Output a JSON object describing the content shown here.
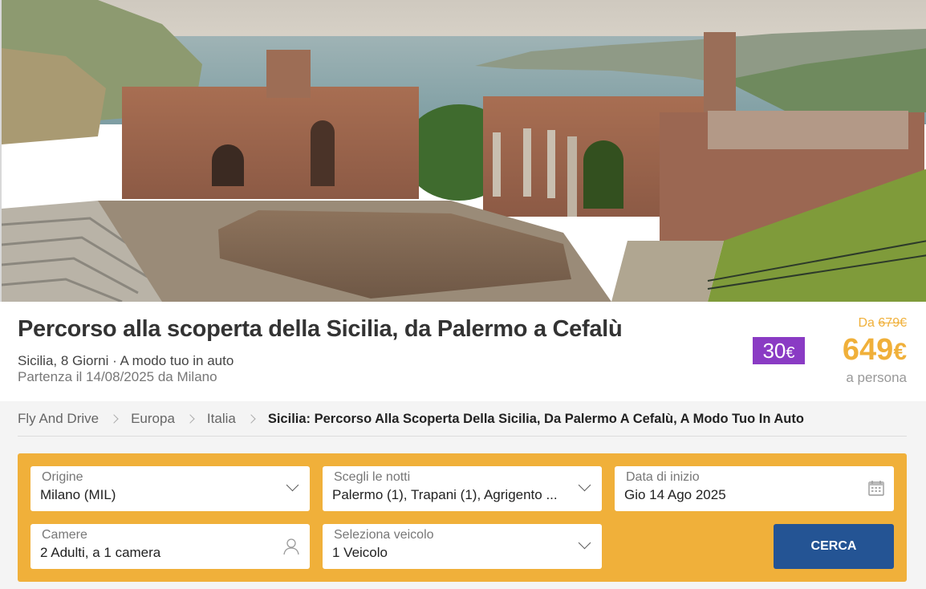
{
  "hero": {
    "image_alt": "Teatro Antico di Taormina, Sicilia"
  },
  "header": {
    "title": "Percorso alla scoperta della Sicilia, da Palermo a Cefalù",
    "subtitle": "Sicilia, 8 Giorni · A modo tuo in auto",
    "departure": "Partenza il 14/08/2025 da Milano",
    "discount_value": "30",
    "discount_currency": "€",
    "price_prefix": "Da",
    "old_price": "679€",
    "new_price_value": "649",
    "new_price_currency": "€",
    "per_person": "a persona"
  },
  "breadcrumb": {
    "items": [
      "Fly And Drive",
      "Europa",
      "Italia"
    ],
    "current": "Sicilia: Percorso Alla Scoperta Della Sicilia, Da Palermo A Cefalù, A Modo Tuo In Auto"
  },
  "search": {
    "origin": {
      "label": "Origine",
      "value": "Milano (MIL)"
    },
    "nights": {
      "label": "Scegli le notti",
      "value": "Palermo (1), Trapani (1), Agrigento ..."
    },
    "start_date": {
      "label": "Data di inizio",
      "value": "Gio 14 Ago 2025"
    },
    "rooms": {
      "label": "Camere",
      "value": "2 Adulti, a 1 camera"
    },
    "vehicle": {
      "label": "Seleziona veicolo",
      "value": "1 Veicolo"
    },
    "submit_label": "CERCA"
  },
  "colors": {
    "accent": "#f0b03a",
    "discount_badge": "#8a3bc4",
    "button": "#245494"
  }
}
